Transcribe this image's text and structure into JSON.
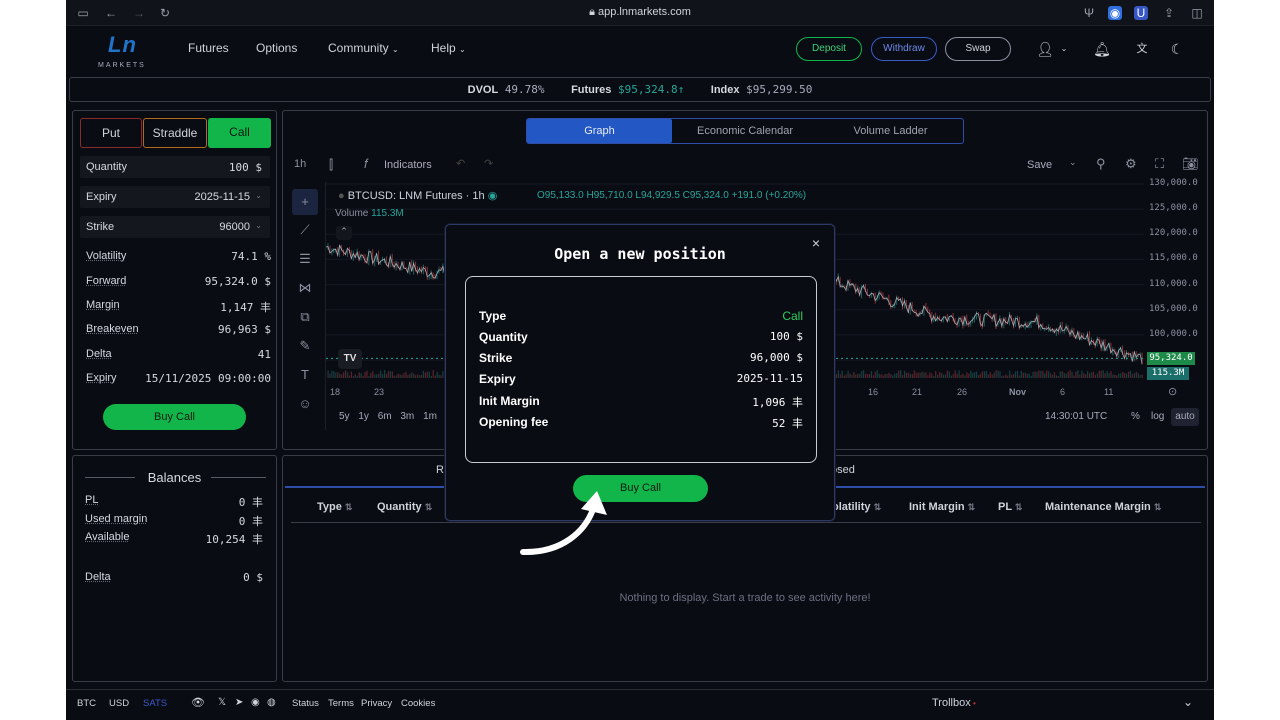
{
  "browser": {
    "url": "app.lnmarkets.com"
  },
  "brand": {
    "logo_text": "Ln",
    "logo_sub": "MARKETS"
  },
  "nav": {
    "menu": [
      "Futures",
      "Options",
      "Community",
      "Help"
    ],
    "deposit": "Deposit",
    "withdraw": "Withdraw",
    "swap": "Swap"
  },
  "ticker": {
    "dvol_label": "DVOL",
    "dvol_value": "49.78%",
    "futures_label": "Futures",
    "futures_value": "$95,324.8",
    "index_label": "Index",
    "index_value": "$95,299.50"
  },
  "order": {
    "types": [
      "Put",
      "Straddle",
      "Call"
    ],
    "selected_type": "Call",
    "quantity_label": "Quantity",
    "quantity_value": "100 $",
    "expiry_label": "Expiry",
    "expiry_value": "2025-11-15",
    "strike_label": "Strike",
    "strike_value": "96000",
    "stats": [
      {
        "label": "Volatility",
        "value": "74.1 %"
      },
      {
        "label": "Forward",
        "value": "95,324.0 $"
      },
      {
        "label": "Margin",
        "value": "1,147 丰"
      },
      {
        "label": "Breakeven",
        "value": "96,963 $"
      },
      {
        "label": "Delta",
        "value": "41"
      },
      {
        "label": "Expiry",
        "value": "15/11/2025 09:00:00"
      }
    ],
    "buy_button": "Buy Call"
  },
  "balances": {
    "title": "Balances",
    "items": [
      {
        "label": "PL",
        "value": "0 丰"
      },
      {
        "label": "Used margin",
        "value": "0 丰"
      },
      {
        "label": "Available",
        "value": "10,254 丰"
      }
    ],
    "delta_label": "Delta",
    "delta_value": "0 $"
  },
  "chart_tabs": [
    "Graph",
    "Economic Calendar",
    "Volume Ladder"
  ],
  "chart_toolbar": {
    "interval": "1h",
    "indicators": "Indicators",
    "save": "Save"
  },
  "chart": {
    "symbol": "BTCUSD: LNM Futures · 1h",
    "ohlc": "O95,133.0 H95,710.0 L94,929.5 C95,324.0 +191.0 (+0.20%)",
    "volume_label": "Volume",
    "volume_value": "115.3M",
    "price_tag": "95,324.0",
    "volume_tag": "115.3M",
    "timeframes": [
      "5y",
      "1y",
      "6m",
      "3m",
      "1m"
    ],
    "clock": "14:30:01 UTC",
    "pct": "%",
    "log": "log",
    "auto": "auto",
    "up_color": "#26a69a",
    "down_color": "#ef5350"
  },
  "chart_data": {
    "type": "line",
    "title": "BTCUSD: LNM Futures · 1h",
    "y_ticks": [
      "130,000.0",
      "125,000.0",
      "120,000.0",
      "115,000.0",
      "110,000.0",
      "105,000.0",
      "100,000.0"
    ],
    "x_ticks": [
      "18",
      "23",
      "16",
      "21",
      "26",
      "Nov",
      "6",
      "11"
    ],
    "x": [
      "18",
      "23",
      "16",
      "21",
      "26",
      "Nov",
      "6",
      "11"
    ],
    "series": [
      {
        "values": [
          117500,
          112500,
          112000,
          109500,
          114000,
          110500,
          103500,
          102500
        ]
      }
    ],
    "last_value": 95324.0,
    "ylim": [
      95000,
      130000
    ]
  },
  "positions": {
    "tab_running": "Ru",
    "tab_closed": "osed",
    "columns_left": [
      "Type",
      "Quantity"
    ],
    "columns_right": [
      "olatility",
      "Init Margin",
      "PL",
      "Maintenance Margin"
    ],
    "empty": "Nothing to display. Start a trade to see activity here!"
  },
  "modal": {
    "title": "Open a new position",
    "close": "×",
    "rows": [
      {
        "label": "Type",
        "value": "Call"
      },
      {
        "label": "Quantity",
        "value": "100 $"
      },
      {
        "label": "Strike",
        "value": "96,000 $"
      },
      {
        "label": "Expiry",
        "value": "2025-11-15"
      },
      {
        "label": "Init Margin",
        "value": "1,096 丰"
      },
      {
        "label": "Opening fee",
        "value": "52 丰"
      }
    ],
    "confirm": "Buy Call"
  },
  "footer": {
    "units": [
      "BTC",
      "USD",
      "SATS"
    ],
    "links": [
      "Status",
      "Terms",
      "Privacy",
      "Cookies"
    ],
    "trollbox": "Trollbox"
  },
  "colors": {
    "accent_green": "#12b54a",
    "accent_blue": "#1f74c9",
    "put_red": "#c0392b"
  }
}
